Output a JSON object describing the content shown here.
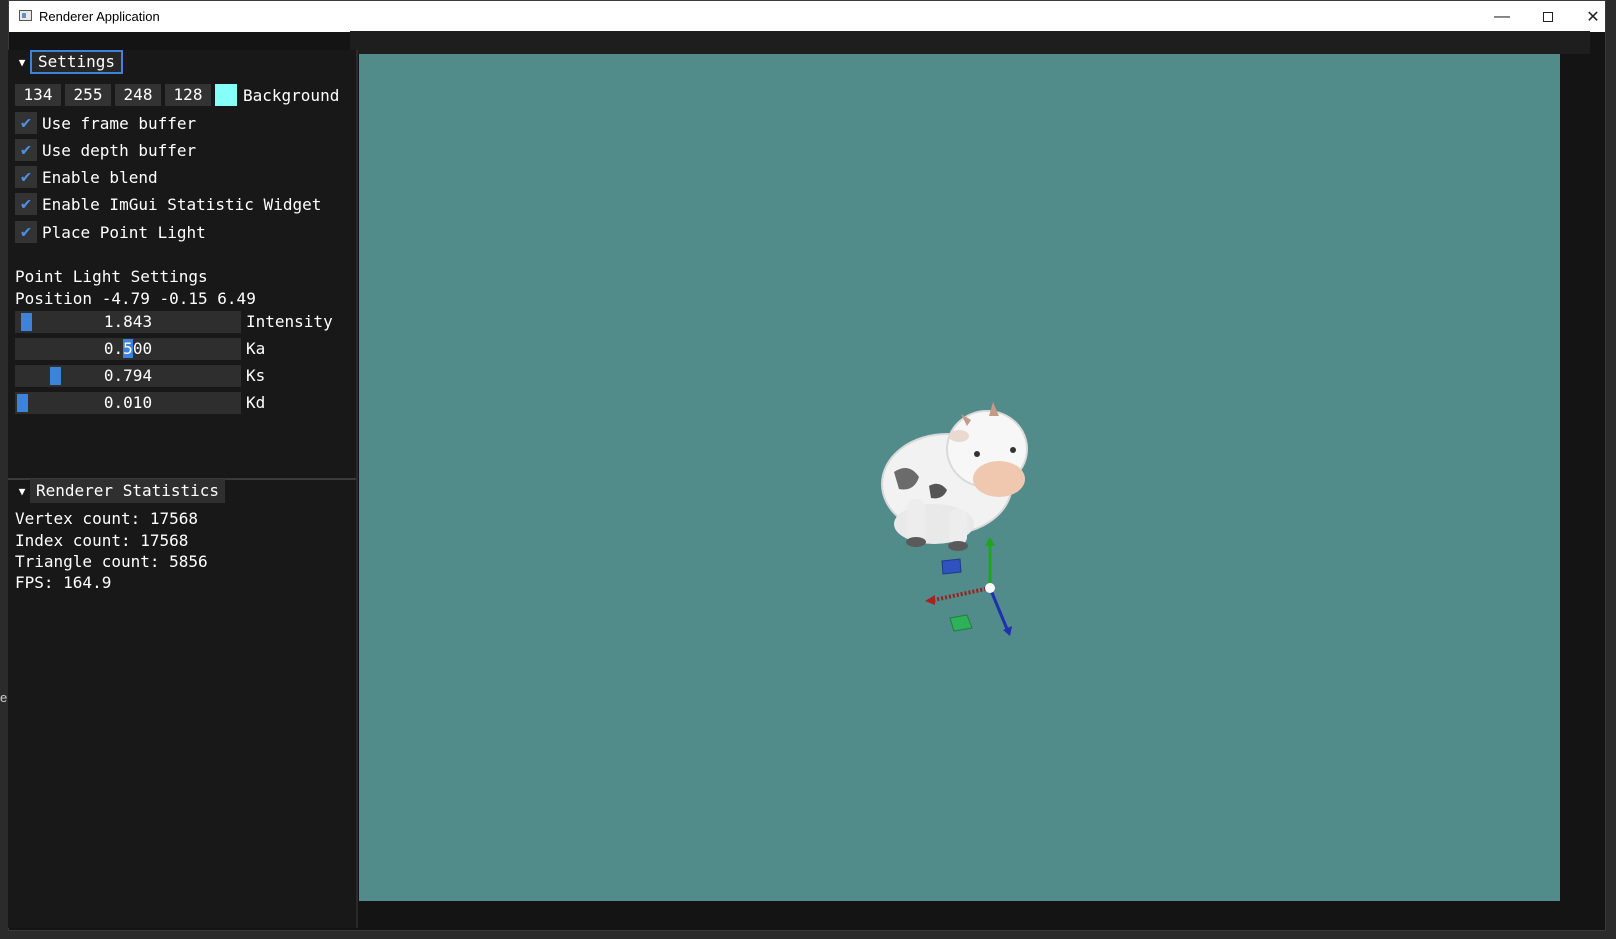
{
  "window": {
    "title": "Renderer Application"
  },
  "settings": {
    "header": "Settings",
    "background": {
      "values": [
        "134",
        "255",
        "248",
        "128"
      ],
      "swatch_color": "#86fff8",
      "label": "Background"
    },
    "checkboxes": [
      {
        "label": "Use frame buffer",
        "checked": true
      },
      {
        "label": "Use depth buffer",
        "checked": true
      },
      {
        "label": "Enable blend",
        "checked": true
      },
      {
        "label": "Enable ImGui Statistic Widget",
        "checked": true
      },
      {
        "label": "Place Point Light",
        "checked": true
      }
    ],
    "point_light": {
      "title": "Point Light Settings",
      "position": "Position -4.79 -0.15 6.49",
      "sliders": [
        {
          "value": "1.843",
          "label": "Intensity"
        },
        {
          "value_pre": "0.",
          "value_sel": "5",
          "value_post": "00",
          "label": "Ka"
        },
        {
          "value": "0.794",
          "label": "Ks"
        },
        {
          "value": "0.010",
          "label": "Kd"
        }
      ]
    }
  },
  "stats": {
    "header": "Renderer Statistics",
    "lines": [
      "Vertex count: 17568",
      "Index count: 17568",
      "Triangle count: 5856",
      "FPS: 164.9"
    ]
  },
  "colors": {
    "viewport_bg": "#518b8a",
    "accent": "#3d83d9"
  },
  "icons": {
    "collapse": "triangle-down-icon",
    "check": "check-icon",
    "minimize": "minimize-icon",
    "maximize": "maximize-icon",
    "close": "close-icon"
  }
}
